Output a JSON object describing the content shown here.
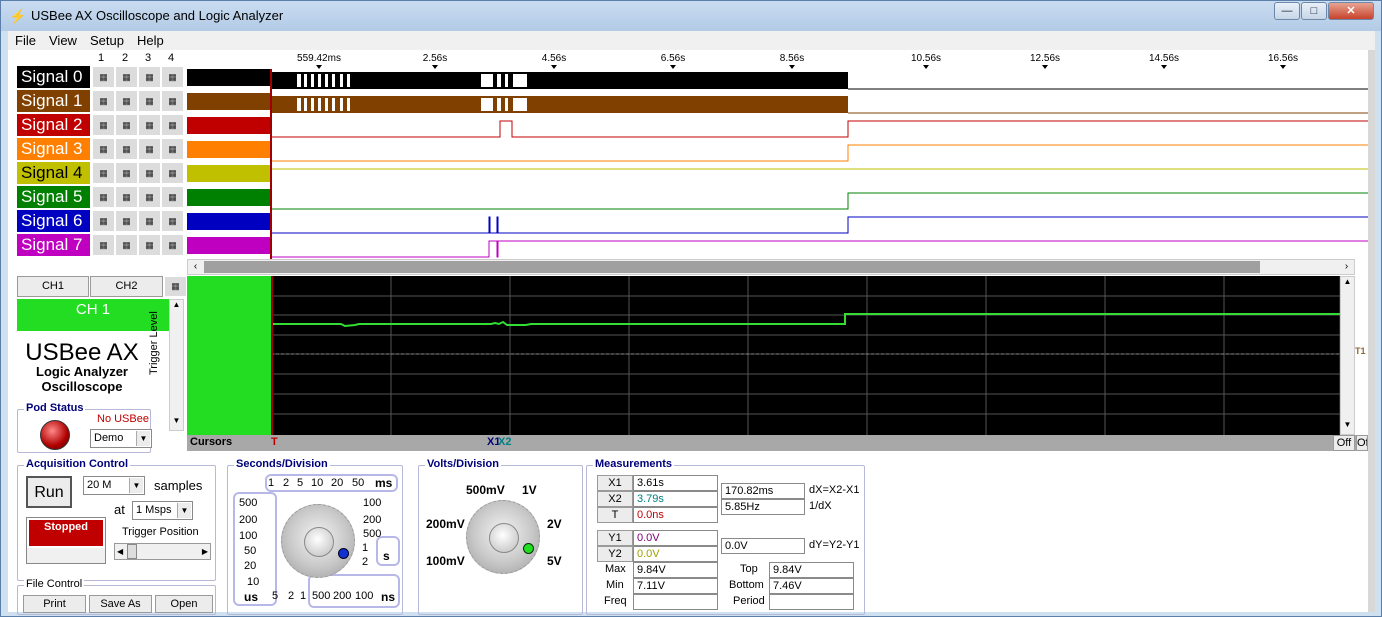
{
  "window": {
    "title": "USBee AX Oscilloscope and Logic Analyzer",
    "minimize": "—",
    "maximize": "□",
    "close": "✕"
  },
  "menu": [
    "File",
    "View",
    "Setup",
    "Help"
  ],
  "columns": [
    "1",
    "2",
    "3",
    "4"
  ],
  "time_ticks": [
    "559.42ms",
    "2.56s",
    "4.56s",
    "6.56s",
    "8.56s",
    "10.56s",
    "12.56s",
    "14.56s",
    "16.56s"
  ],
  "signals": [
    {
      "name": "Signal 0",
      "color": "#000000",
      "text_color": "#ffffff"
    },
    {
      "name": "Signal 1",
      "color": "#804000",
      "text_color": "#ffffff"
    },
    {
      "name": "Signal 2",
      "color": "#c00000",
      "text_color": "#ffffff"
    },
    {
      "name": "Signal 3",
      "color": "#ff8000",
      "text_color": "#ffffff"
    },
    {
      "name": "Signal 4",
      "color": "#c0c000",
      "text_color": "#000000"
    },
    {
      "name": "Signal 5",
      "color": "#008000",
      "text_color": "#ffffff"
    },
    {
      "name": "Signal 6",
      "color": "#0000c0",
      "text_color": "#ffffff"
    },
    {
      "name": "Signal 7",
      "color": "#c000c0",
      "text_color": "#ffffff"
    }
  ],
  "channels": {
    "tab1": "CH1",
    "tab2": "CH2",
    "active": "CH 1",
    "trace_color": "#33dd33"
  },
  "branding": {
    "name": "USBee AX",
    "line1": "Logic Analyzer",
    "line2": "Oscilloscope"
  },
  "trigger_level_label": "Trigger Level",
  "pod_status": {
    "title": "Pod Status",
    "state": "No USBee",
    "mode": "Demo"
  },
  "cursors": {
    "label": "Cursors",
    "trigger_marker": "T",
    "x1": "X1",
    "x2": "X2",
    "off1": "Off",
    "off2": "Off",
    "right_label": "T1"
  },
  "acquisition": {
    "title": "Acquisition Control",
    "run": "Run",
    "samples_value": "20 M",
    "samples_label": "samples",
    "at": "at",
    "rate": "1 Msps",
    "status": "Stopped",
    "trigger_position": "Trigger Position"
  },
  "file_control": {
    "title": "File Control",
    "print": "Print",
    "save_as": "Save As",
    "open": "Open"
  },
  "seconds_division": {
    "title": "Seconds/Division",
    "ms_labels": [
      "1",
      "2",
      "5",
      "10",
      "20",
      "50"
    ],
    "ms_unit": "ms",
    "left_labels": [
      "500",
      "200",
      "100",
      "50",
      "20",
      "10"
    ],
    "right_labels": [
      "100",
      "200",
      "500",
      "1",
      "2"
    ],
    "s_unit": "s",
    "us_unit": "us",
    "bottom_labels": [
      "5",
      "2",
      "1"
    ],
    "ns_labels": [
      "500",
      "200",
      "100"
    ],
    "ns_unit": "ns"
  },
  "volts_division": {
    "title": "Volts/Division",
    "v500m": "500mV",
    "v1": "1V",
    "v200m": "200mV",
    "v2": "2V",
    "v100m": "100mV",
    "v5": "5V"
  },
  "measurements": {
    "title": "Measurements",
    "X1": "3.61s",
    "X2": "3.79s",
    "T": "0.0ns",
    "dX": "170.82ms",
    "dX_label": "dX=X2-X1",
    "inv": "5.85Hz",
    "inv_label": "1/dX",
    "Y1": "0.0V",
    "Y2": "0.0V",
    "dY": "0.0V",
    "dY_label": "dY=Y2-Y1",
    "max_label": "Max",
    "max": "9.84V",
    "min_label": "Min",
    "min": "7.11V",
    "freq_label": "Freq",
    "freq": "",
    "top_label": "Top",
    "top": "9.84V",
    "bottom_label": "Bottom",
    "bottom": "7.46V",
    "period_label": "Period",
    "period": ""
  }
}
